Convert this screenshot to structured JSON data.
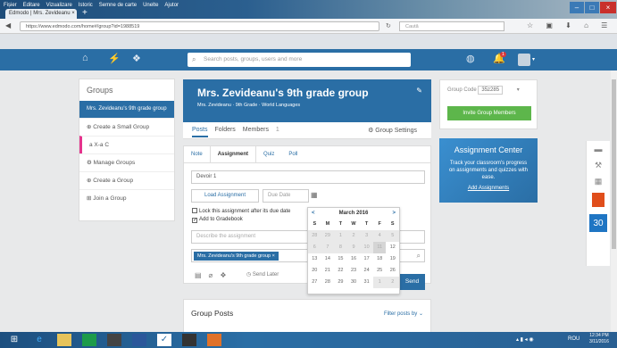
{
  "browser": {
    "menu": [
      "Fișier",
      "Editare",
      "Vizualizare",
      "Istoric",
      "Semne de carte",
      "Unelte",
      "Ajutor"
    ],
    "tab_title": "Edmodo | Mrs. Zevideanu",
    "url": "https://www.edmodo.com/home#/group?id=1988519",
    "search_placeholder": "Caută"
  },
  "nav": {
    "search_placeholder": "Search posts, groups, users and more",
    "notif_count": "1"
  },
  "sidebar": {
    "title": "Groups",
    "selected": "Mrs. Zevideanu's 9th grade group",
    "items": [
      "Create a Small Group",
      "a X-a C",
      "Manage Groups",
      "Create a Group",
      "Join a Group"
    ]
  },
  "group": {
    "title": "Mrs. Zevideanu's 9th grade group",
    "subtitle": "Mrs. Zevideanu · 9th Grade · World Languages",
    "tabs": [
      "Posts",
      "Folders",
      "Members"
    ],
    "members_count": "1",
    "settings_label": "Group Settings"
  },
  "composer": {
    "tabs": [
      "Note",
      "Assignment",
      "Quiz",
      "Poll"
    ],
    "assignment_title": "Devoir 1",
    "load_label": "Load Assignment",
    "due_placeholder": "Due Date",
    "lock_label": "Lock this assignment after its due date",
    "gradebook_label": "Add to Gradebook",
    "describe_placeholder": "Describe the assignment",
    "recipient": "Mrs. Zevideanu's 9th grade group",
    "send_later": "Send Later",
    "send": "Send"
  },
  "calendar": {
    "month": "March 2016",
    "days": [
      "S",
      "M",
      "T",
      "W",
      "T",
      "F",
      "S"
    ],
    "weeks": [
      [
        "28",
        "29",
        "1",
        "2",
        "3",
        "4",
        "5"
      ],
      [
        "6",
        "7",
        "8",
        "9",
        "10",
        "11",
        "12"
      ],
      [
        "13",
        "14",
        "15",
        "16",
        "17",
        "18",
        "19"
      ],
      [
        "20",
        "21",
        "22",
        "23",
        "24",
        "25",
        "26"
      ],
      [
        "27",
        "28",
        "29",
        "30",
        "31",
        "1",
        "2"
      ]
    ]
  },
  "posts": {
    "title": "Group Posts",
    "filter": "Filter posts by"
  },
  "right": {
    "code_label": "Group Code",
    "code": "35z285",
    "invite": "Invite Group Members",
    "ac_title": "Assignment Center",
    "ac_desc": "Track your classroom's progress on assignments and quizzes with ease.",
    "ac_link": "Add Assignments"
  },
  "calendar_widget": {
    "day": "30"
  },
  "taskbar": {
    "lang": "ROU",
    "time": "12:34 PM",
    "date": "3/11/2016"
  }
}
